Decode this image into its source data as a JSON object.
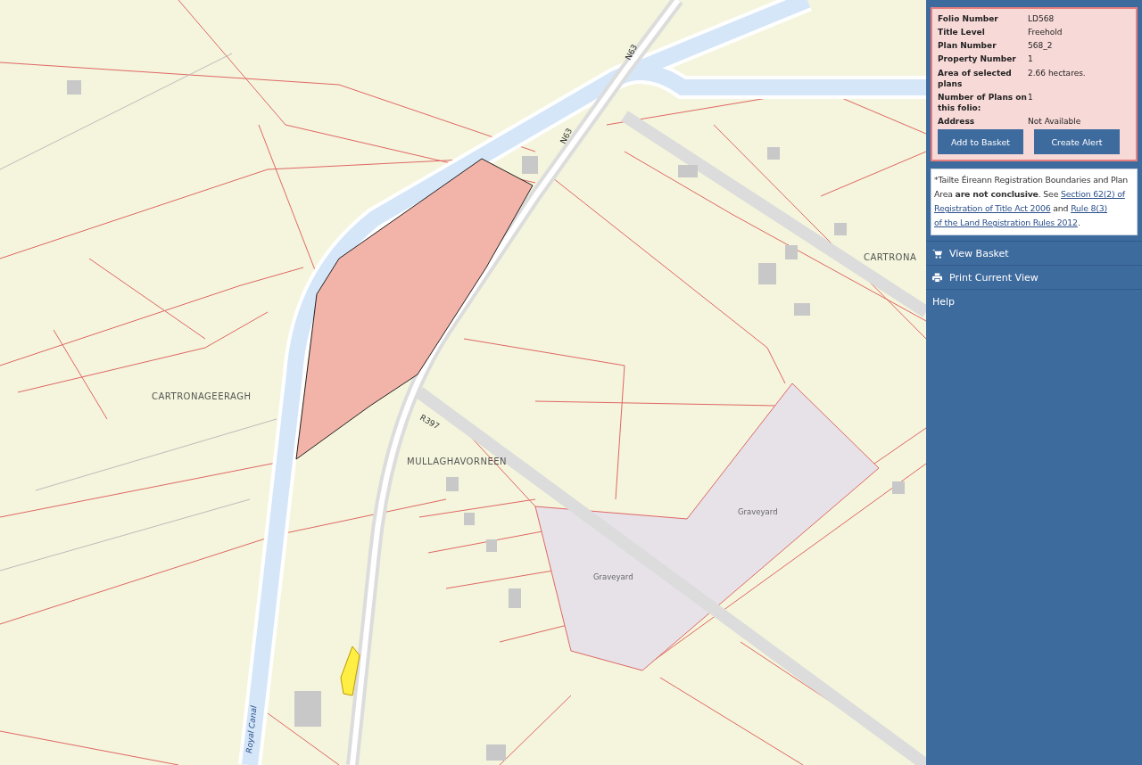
{
  "map": {
    "labels": [
      {
        "kind": "place",
        "text": "CARTRONAGEERAGH"
      },
      {
        "kind": "place",
        "text": "MULLAGHAVORNEEN"
      },
      {
        "kind": "place",
        "text": "CARTRONA"
      },
      {
        "kind": "feature",
        "text": "Graveyard"
      },
      {
        "kind": "feature",
        "text": "Graveyard"
      },
      {
        "kind": "road",
        "text": "R397"
      },
      {
        "kind": "road",
        "text": "N63"
      },
      {
        "kind": "road",
        "text": "N63"
      },
      {
        "kind": "water",
        "text": "Royal Canal"
      }
    ]
  },
  "folio": {
    "fields": [
      {
        "label": "Folio Number",
        "value": "LD568"
      },
      {
        "label": "Title Level",
        "value": "Freehold"
      },
      {
        "label": "Plan Number",
        "value": "568_2"
      },
      {
        "label": "Property Number",
        "value": "1"
      },
      {
        "label": "Area of selected plans",
        "value": "2.66 hectares."
      },
      {
        "label": "Number of Plans on this folio:",
        "value": "1"
      },
      {
        "label": "Address",
        "value": "Not Available"
      }
    ],
    "buttons": [
      "Add to Basket",
      "Create Alert"
    ]
  },
  "notice": [
    {
      "kind": "text",
      "text": "*Tailte Éireann Registration Boundaries and Plan Area "
    },
    {
      "kind": "bold",
      "text": "are not conclusive"
    },
    {
      "kind": "text",
      "text": ". See "
    },
    {
      "kind": "link",
      "text": "Section 62(2) of"
    },
    {
      "kind": "link",
      "text": "Registration of Title Act 2006"
    },
    {
      "kind": "text",
      "text": " and "
    },
    {
      "kind": "link",
      "text": "Rule 8(3)"
    },
    {
      "kind": "link",
      "text": "of the Land Registration Rules 2012"
    },
    {
      "kind": "text",
      "text": "."
    }
  ],
  "menu": [
    {
      "label": "View Basket"
    },
    {
      "label": "Print Current View"
    },
    {
      "label": "Help"
    }
  ]
}
